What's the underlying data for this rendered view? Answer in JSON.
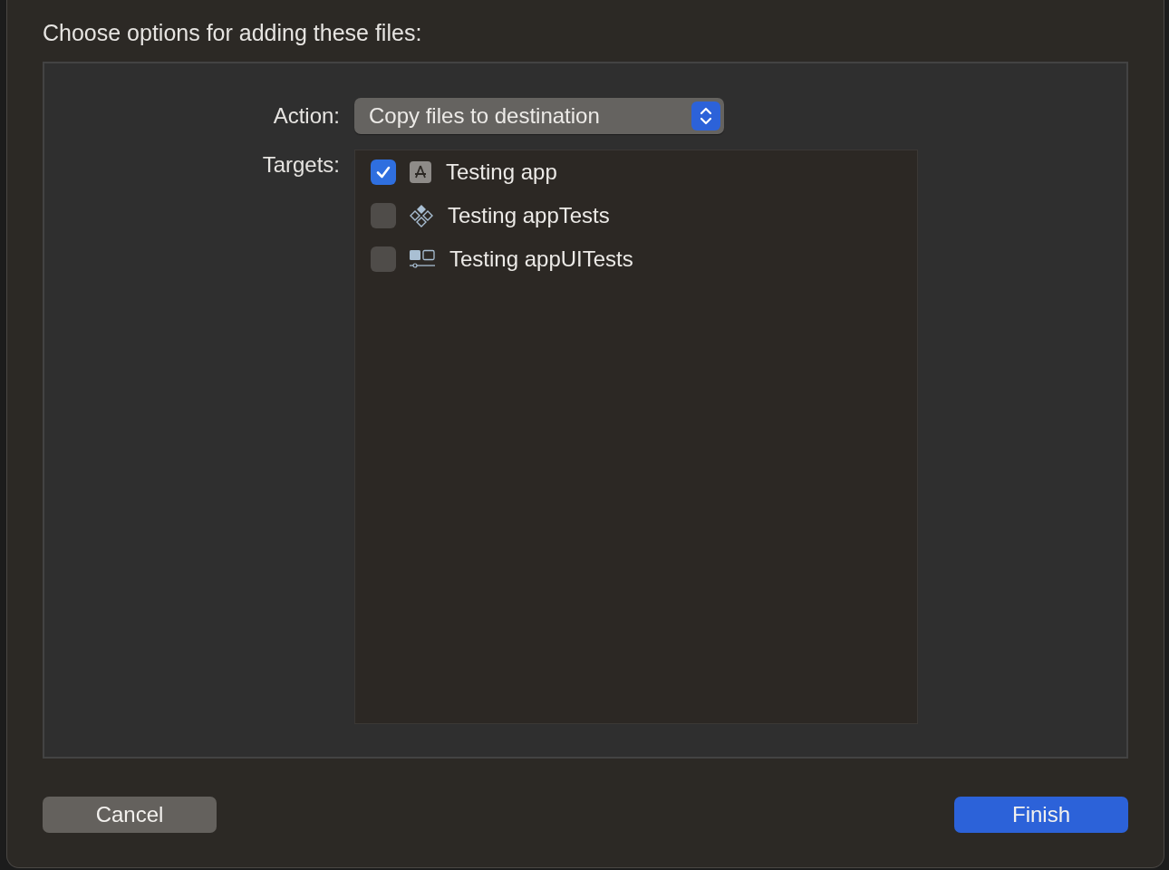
{
  "title": "Choose options for adding these files:",
  "action": {
    "label": "Action:",
    "value": "Copy files to destination"
  },
  "targets": {
    "label": "Targets:",
    "items": [
      {
        "kind": "app",
        "name": "Testing app",
        "checked": true
      },
      {
        "kind": "unit-tests",
        "name": "Testing appTests",
        "checked": false
      },
      {
        "kind": "ui-tests",
        "name": "Testing appUITests",
        "checked": false
      }
    ]
  },
  "buttons": [
    {
      "label": "Cancel",
      "kind": "secondary"
    },
    {
      "label": "Finish",
      "kind": "primary"
    }
  ]
}
